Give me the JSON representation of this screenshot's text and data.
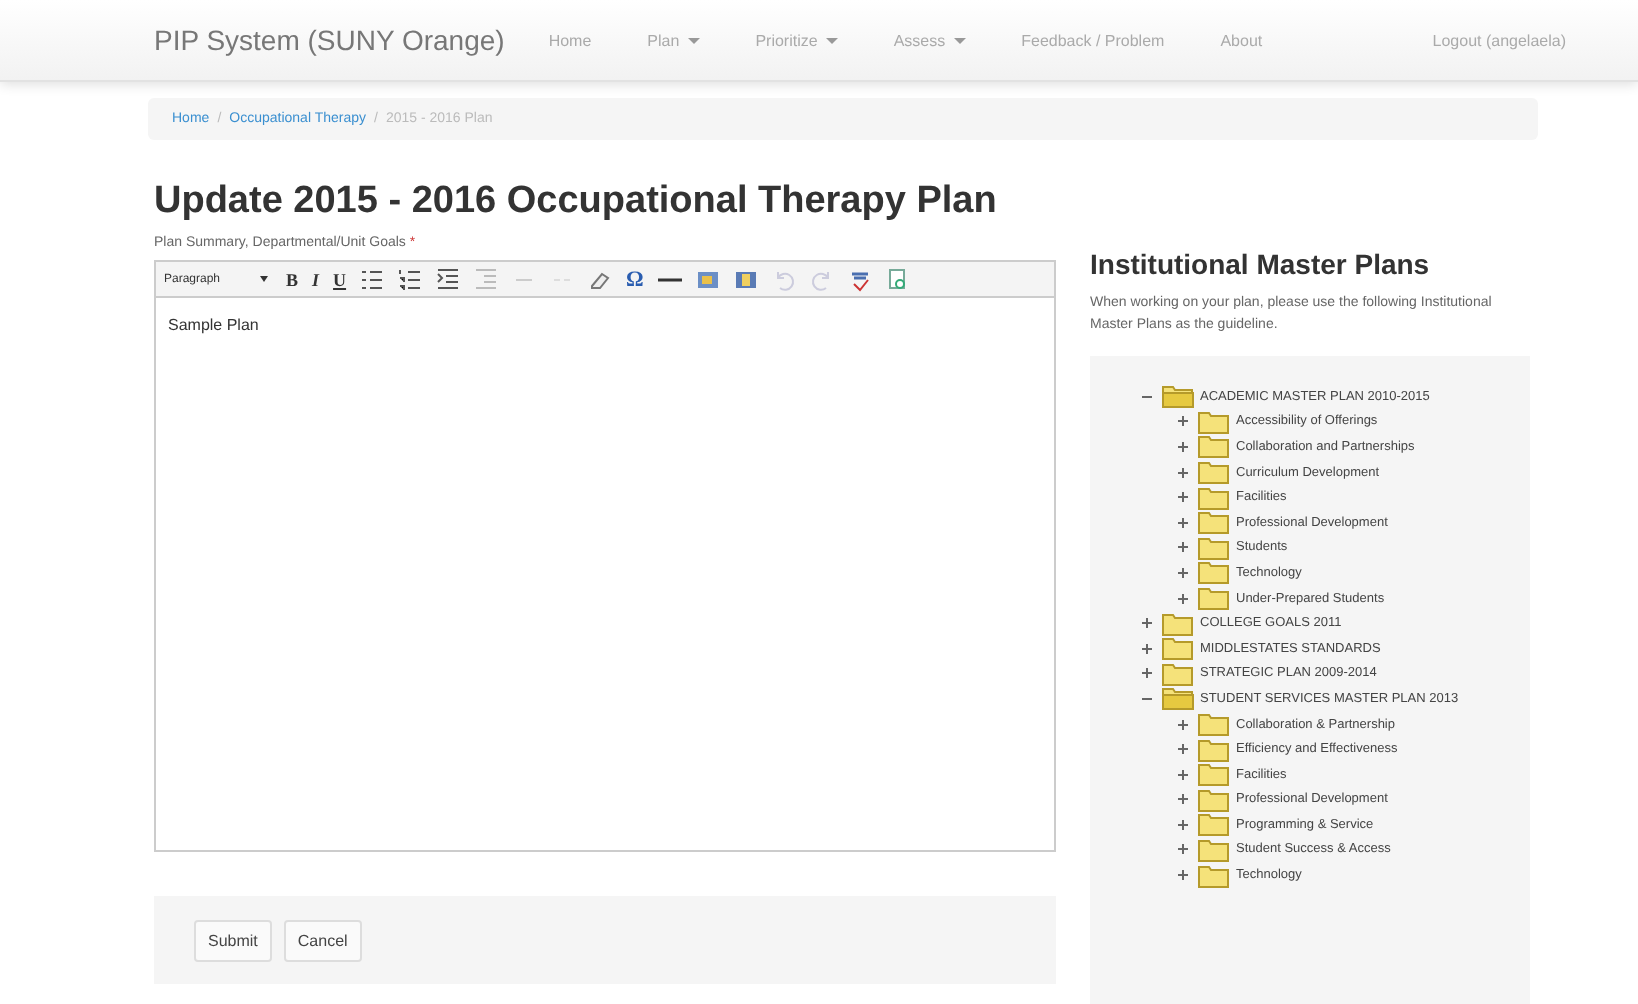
{
  "navbar": {
    "brand": "PIP System (SUNY Orange)",
    "items": [
      {
        "label": "Home",
        "dropdown": false
      },
      {
        "label": "Plan",
        "dropdown": true
      },
      {
        "label": "Prioritize",
        "dropdown": true
      },
      {
        "label": "Assess",
        "dropdown": true
      },
      {
        "label": "Feedback / Problem",
        "dropdown": false
      },
      {
        "label": "About",
        "dropdown": false
      }
    ],
    "user": "Logout (angelaela)"
  },
  "breadcrumb": [
    {
      "label": "Home",
      "link": true
    },
    {
      "separator": "/",
      "label": "Occupational Therapy",
      "link": true
    },
    {
      "separator": "/",
      "label": "2015 - 2016 Plan",
      "link": false
    }
  ],
  "title": "Update 2015 - 2016 Occupational Therapy Plan",
  "field_label": "Plan Summary, Departmental/Unit Goals",
  "required_mark": "*",
  "editor": {
    "format": "Paragraph",
    "style_buttons": [
      "B",
      "I",
      "U"
    ],
    "symbol": "Ω",
    "value": "Sample Plan"
  },
  "buttons": [
    "Submit",
    "Cancel"
  ],
  "sidebar": {
    "title": "Institutional Master Plans",
    "text": "When working on your plan, please use the following Institutional Master Plans as the guideline.",
    "tree": [
      {
        "label": "ACADEMIC MASTER PLAN 2010-2015",
        "expanded": true,
        "children": [
          {
            "label": "Accessibility of Offerings",
            "expanded": false
          },
          {
            "label": "Collaboration and Partnerships",
            "expanded": false
          },
          {
            "label": "Curriculum Development",
            "expanded": false
          },
          {
            "label": "Facilities",
            "expanded": false
          },
          {
            "label": "Professional Development",
            "expanded": false
          },
          {
            "label": "Students",
            "expanded": false
          },
          {
            "label": "Technology",
            "expanded": false
          },
          {
            "label": "Under-Prepared Students",
            "expanded": false
          }
        ]
      },
      {
        "label": "COLLEGE GOALS 2011",
        "expanded": false
      },
      {
        "label": "MIDDLESTATES STANDARDS",
        "expanded": false
      },
      {
        "label": "STRATEGIC PLAN 2009-2014",
        "expanded": false
      },
      {
        "label": "STUDENT SERVICES MASTER PLAN 2013",
        "expanded": true,
        "children": [
          {
            "label": "Collaboration & Partnership",
            "expanded": false
          },
          {
            "label": "Efficiency and Effectiveness",
            "expanded": false
          },
          {
            "label": "Facilities",
            "expanded": false
          },
          {
            "label": "Professional Development",
            "expanded": false
          },
          {
            "label": "Programming & Service",
            "expanded": false
          },
          {
            "label": "Student Success & Access",
            "expanded": false
          },
          {
            "label": "Technology",
            "expanded": false
          }
        ]
      }
    ]
  }
}
